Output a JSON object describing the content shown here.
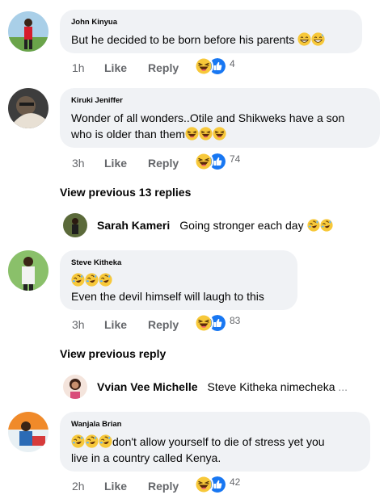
{
  "comments": [
    {
      "author": "John Kinyua",
      "text": "But he decided to be born before his parents",
      "time": "1h",
      "like": "Like",
      "reply": "Reply",
      "reaction_count": "4"
    },
    {
      "author": "Kiruki Jeniffer",
      "text_line1": "Wonder of all wonders..Otile and Shikweks have a son",
      "text_line2": "who is older than them",
      "time": "3h",
      "like": "Like",
      "reply": "Reply",
      "reaction_count": "74"
    },
    {
      "author": "Steve Kitheka",
      "text": "Even the devil himself will laugh to this",
      "time": "3h",
      "like": "Like",
      "reply": "Reply",
      "reaction_count": "83"
    },
    {
      "author": "Wanjala Brian",
      "text_line1": "don't allow yourself to die of stress yet you",
      "text_line2": "live in a country called Kenya.",
      "time": "2h",
      "like": "Like",
      "reply": "Reply",
      "reaction_count": "42"
    }
  ],
  "view_previous_13": "View previous 13 replies",
  "view_previous_reply": "View previous reply",
  "inline_replies": [
    {
      "name": "Sarah Kameri",
      "text": "Going stronger each day"
    },
    {
      "name": "Vvian Vee Michelle",
      "text": "Steve Kitheka nimecheka",
      "ellipsis": "..."
    }
  ],
  "icons": {
    "haha": "laughing-face-emoji",
    "like": "thumbs-up-reaction",
    "grin": "grinning-sweat-emoji"
  },
  "colors": {
    "bubble": "#f0f2f5",
    "meta": "#65676b",
    "like_blue": "#1877f2",
    "haha_yellow": "#f7b928"
  }
}
